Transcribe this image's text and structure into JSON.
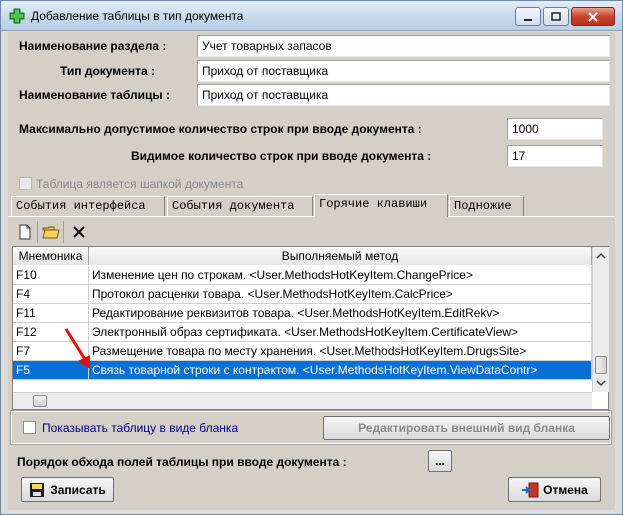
{
  "window": {
    "title": "Добавление таблицы в тип документа",
    "icon": "green-plus-icon"
  },
  "form": {
    "section_label": "Наименование раздела :",
    "section_value": "Учет товарных запасов",
    "doctype_label": "Тип документа :",
    "doctype_value": "Приход от поставщика",
    "table_label": "Наименование таблицы :",
    "table_value": "Приход от поставщика",
    "maxrows_label": "Максимально допустимое количество строк при вводе документа :",
    "maxrows_value": "1000",
    "visrows_label": "Видимое количество строк при вводе документа :",
    "visrows_value": "17",
    "header_checkbox_label": "Таблица является шапкой документа"
  },
  "tabs": [
    {
      "label": "События интерфейса"
    },
    {
      "label": "События документа"
    },
    {
      "label": "Горячие клавиши"
    },
    {
      "label": "Подножие"
    }
  ],
  "active_tab": "Горячие клавиши",
  "toolbar": {
    "new_icon": "new-document-icon",
    "open_icon": "open-folder-icon",
    "delete_icon": "delete-x-icon"
  },
  "grid": {
    "columns": [
      "Мнемоника",
      "Выполняемый метод"
    ],
    "rows": [
      {
        "key": "F10",
        "method": "Изменение цен по строкам.  <User.MethodsHotKeyItem.ChangePrice>"
      },
      {
        "key": "F4",
        "method": "Протокол расценки товара. <User.MethodsHotKeyItem.CalcPrice>"
      },
      {
        "key": "F11",
        "method": "Редактирование реквизитов товара. <User.MethodsHotKeyItem.EditRekv>"
      },
      {
        "key": "F12",
        "method": "Электронный образ сертификата.  <User.MethodsHotKeyItem.CertificateView>"
      },
      {
        "key": "F7",
        "method": "Размещение товара по месту хранения.  <User.MethodsHotKeyItem.DrugsSite>"
      },
      {
        "key": "F5",
        "method": "Связь товарной строки с контрактом. <User.MethodsHotKeyItem.ViewDataContr>"
      }
    ],
    "selected_key": "F5"
  },
  "blank": {
    "checkbox_label": "Показывать таблицу в виде бланка",
    "edit_button": "Редактировать внешний вид бланка"
  },
  "order": {
    "label": "Порядок обхода полей таблицы при вводе документа :",
    "button": "..."
  },
  "footer": {
    "save_button": "Записать",
    "cancel_button": "Отмена"
  },
  "colors": {
    "selection": "#0a6fd6",
    "link_text": "#00008b",
    "arrow": "#e01010"
  }
}
